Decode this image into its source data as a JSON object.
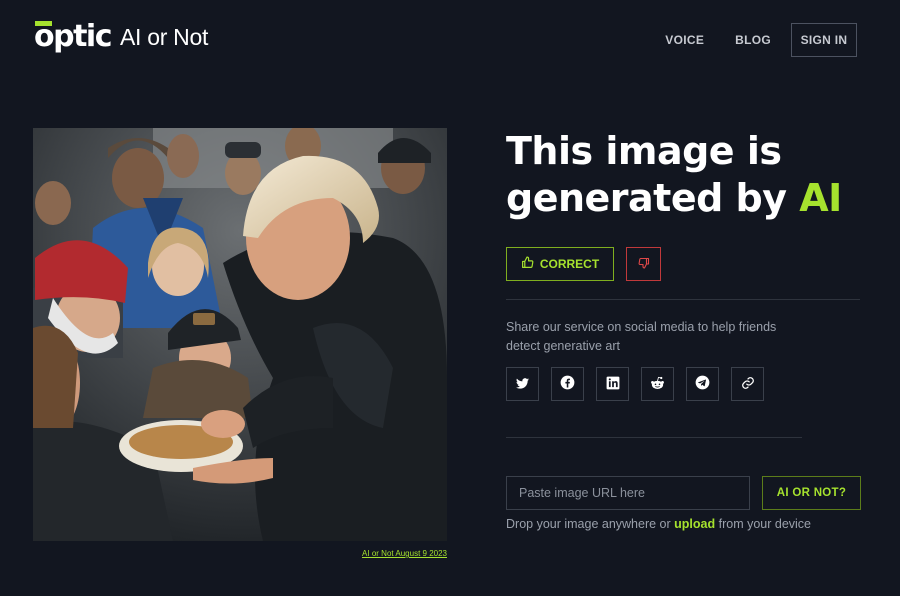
{
  "brand": {
    "logo_text": "optic",
    "product_name": "AI or Not",
    "accent_color": "#a6e22e"
  },
  "nav": {
    "voice": "VOICE",
    "blog": "BLOG",
    "sign_in": "SIGN IN"
  },
  "image_caption": "AI or Not August 9 2023",
  "result": {
    "headline_prefix": "This image is generated by",
    "headline_highlight": "AI"
  },
  "feedback": {
    "correct_label": "CORRECT",
    "correct_icon": "thumbs-up-icon",
    "incorrect_icon": "thumbs-down-icon"
  },
  "share": {
    "text": "Share our service on social media to help friends detect generative art",
    "icons": [
      "twitter-icon",
      "facebook-icon",
      "linkedin-icon",
      "reddit-icon",
      "telegram-icon",
      "link-icon"
    ]
  },
  "check": {
    "placeholder": "Paste image URL here",
    "button_label": "AI OR NOT?"
  },
  "drop": {
    "prefix": "Drop your image anywhere or",
    "link": "upload",
    "suffix": "from your device"
  }
}
